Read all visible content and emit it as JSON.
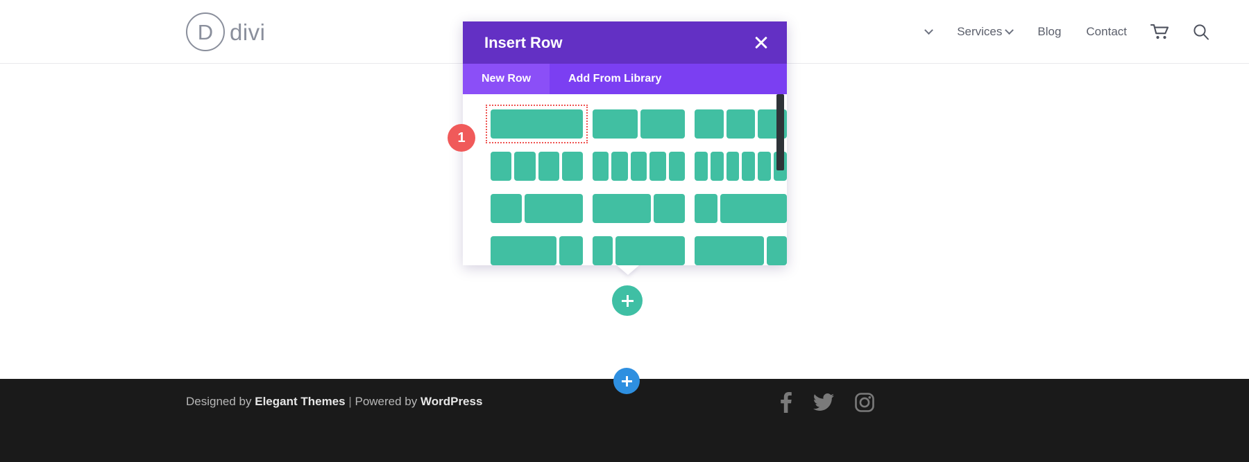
{
  "header": {
    "logo": {
      "mark": "D",
      "text": "divi"
    },
    "nav_items": [
      {
        "label": "",
        "has_dropdown": true,
        "hidden_behind_modal": true
      },
      {
        "label": "Services",
        "has_dropdown": true
      },
      {
        "label": "Blog",
        "has_dropdown": false
      },
      {
        "label": "Contact",
        "has_dropdown": false
      }
    ],
    "icons": [
      {
        "name": "cart-icon"
      },
      {
        "name": "search-icon"
      }
    ]
  },
  "modal": {
    "title": "Insert Row",
    "close_label": "×",
    "tabs": [
      {
        "label": "New Row",
        "active": true
      },
      {
        "label": "Add From Library",
        "active": false
      }
    ],
    "selected_badge": "1",
    "accent_header": "#6330c4",
    "accent_tabs": "#7b3ff2",
    "accent_tab_active": "#8b4ff7",
    "column_color": "#41bfa2",
    "selection_color": "#ef5350",
    "layouts": [
      {
        "name": "1-column",
        "widths": [
          100
        ]
      },
      {
        "name": "2-column",
        "widths": [
          50,
          50
        ]
      },
      {
        "name": "3-column",
        "widths": [
          33,
          33,
          33
        ]
      },
      {
        "name": "4-column",
        "widths": [
          25,
          25,
          25,
          25
        ]
      },
      {
        "name": "5-column",
        "widths": [
          20,
          20,
          20,
          20,
          20
        ]
      },
      {
        "name": "6-column",
        "widths": [
          16,
          16,
          16,
          16,
          16,
          16
        ]
      },
      {
        "name": "1-3-2-3",
        "widths": [
          34,
          64
        ]
      },
      {
        "name": "2-3-1-3",
        "widths": [
          64,
          34
        ]
      },
      {
        "name": "1-4-3-4",
        "widths": [
          25,
          73
        ]
      },
      {
        "name": "3-4-1-4-b",
        "widths": [
          72,
          26
        ]
      },
      {
        "name": "1-4-3-4-b",
        "widths": [
          22,
          76
        ]
      },
      {
        "name": "3-4-1-4-c",
        "widths": [
          76,
          22
        ]
      }
    ]
  },
  "canvas": {
    "add_row_button": {
      "name": "add-row-button",
      "glyph": "+",
      "color": "#3fbfa4"
    },
    "add_section_button": {
      "name": "add-section-button",
      "glyph": "+",
      "color": "#2e8fe0"
    }
  },
  "footer": {
    "credit_prefix": "Designed by ",
    "credit_brand_1": "Elegant Themes",
    "credit_separator": " | ",
    "credit_middle": "Powered by ",
    "credit_brand_2": "WordPress",
    "social": [
      {
        "name": "facebook-icon",
        "label": "Facebook"
      },
      {
        "name": "twitter-icon",
        "label": "Twitter"
      },
      {
        "name": "instagram-icon",
        "label": "Instagram"
      }
    ],
    "background": "#1a1a1a"
  }
}
